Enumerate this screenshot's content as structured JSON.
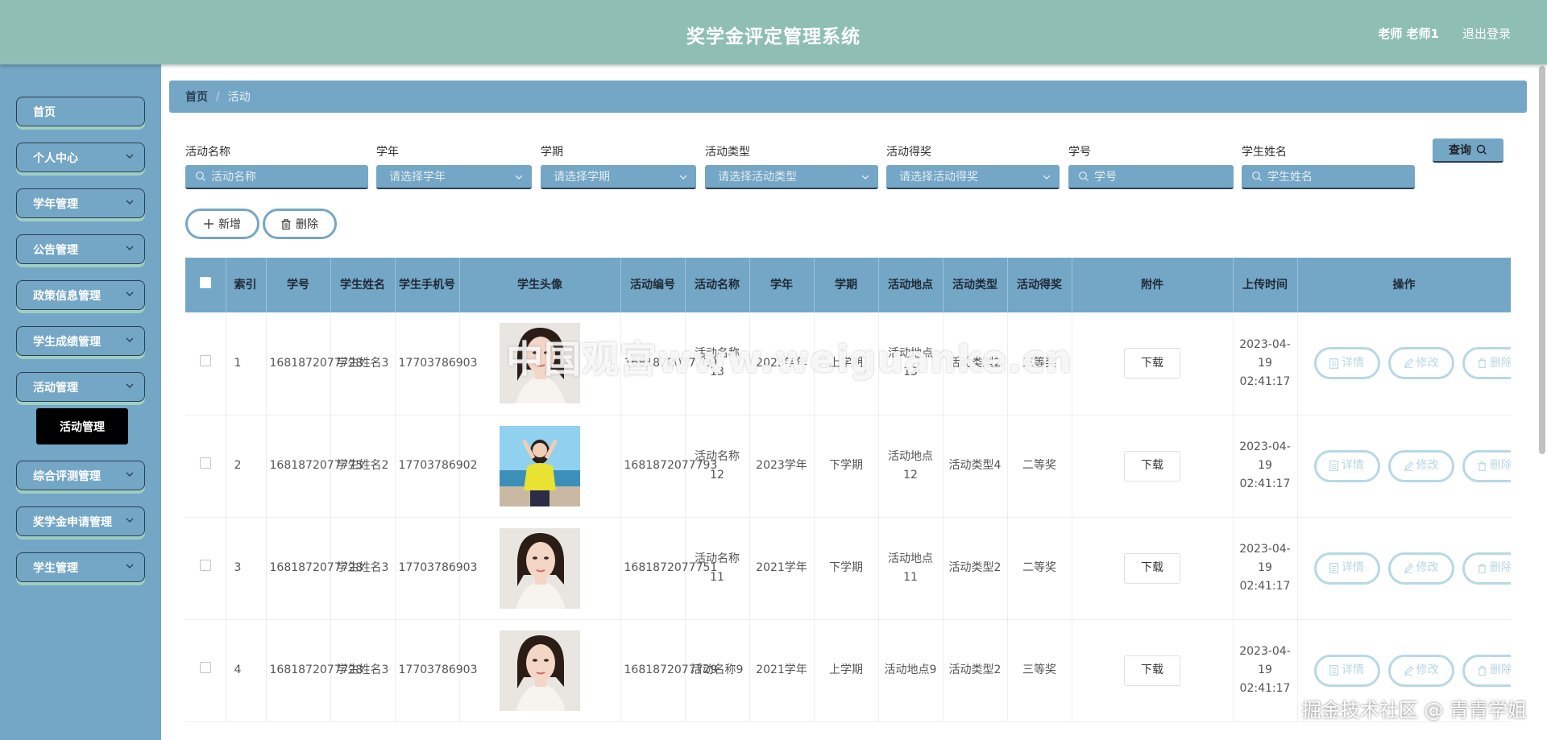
{
  "header": {
    "title": "奖学金评定管理系统",
    "user": "老师 老师1",
    "logout": "退出登录"
  },
  "sidebar": {
    "items": [
      {
        "label": "首页",
        "has_arrow": false
      },
      {
        "label": "个人中心",
        "has_arrow": true
      },
      {
        "label": "学年管理",
        "has_arrow": true
      },
      {
        "label": "公告管理",
        "has_arrow": true
      },
      {
        "label": "政策信息管理",
        "has_arrow": true
      },
      {
        "label": "学生成绩管理",
        "has_arrow": true
      },
      {
        "label": "活动管理",
        "has_arrow": true
      },
      {
        "label": "综合评测管理",
        "has_arrow": true
      },
      {
        "label": "奖学金申请管理",
        "has_arrow": true
      },
      {
        "label": "学生管理",
        "has_arrow": true
      }
    ],
    "active_sub": "活动管理"
  },
  "breadcrumb": {
    "home": "首页",
    "separator": "/",
    "current": "活动"
  },
  "filters": [
    {
      "label": "活动名称",
      "placeholder": "活动名称",
      "type": "input"
    },
    {
      "label": "学年",
      "placeholder": "请选择学年",
      "type": "select"
    },
    {
      "label": "学期",
      "placeholder": "请选择学期",
      "type": "select"
    },
    {
      "label": "活动类型",
      "placeholder": "请选择活动类型",
      "type": "select"
    },
    {
      "label": "活动得奖",
      "placeholder": "请选择活动得奖",
      "type": "select"
    },
    {
      "label": "学号",
      "placeholder": "学号",
      "type": "input"
    },
    {
      "label": "学生姓名",
      "placeholder": "学生姓名",
      "type": "input"
    }
  ],
  "query_label": "查询",
  "actions": {
    "add": "新增",
    "delete": "删除"
  },
  "table": {
    "headers": [
      "索引",
      "学号",
      "学生姓名",
      "学生手机号",
      "学生头像",
      "活动编号",
      "活动名称",
      "学年",
      "学期",
      "活动地点",
      "活动类型",
      "活动得奖",
      "附件",
      "上传时间",
      "操作"
    ],
    "rows": [
      {
        "index": "1",
        "student_id": "1681872077728",
        "student_name": "学生姓名3",
        "phone": "17703786903",
        "avatar": "portrait-a",
        "activity_id": "1681872077719",
        "activity_name": "活动名称13",
        "year": "2023学年",
        "term": "上学期",
        "location": "活动地点13",
        "type": "活动类型2",
        "award": "三等奖",
        "upload_time": "2023-04-19 02:41:17"
      },
      {
        "index": "2",
        "student_id": "1681872077775",
        "student_name": "学生姓名2",
        "phone": "17703786902",
        "avatar": "portrait-b",
        "activity_id": "1681872077793",
        "activity_name": "活动名称12",
        "year": "2023学年",
        "term": "下学期",
        "location": "活动地点12",
        "type": "活动类型4",
        "award": "二等奖",
        "upload_time": "2023-04-19 02:41:17"
      },
      {
        "index": "3",
        "student_id": "1681872077728",
        "student_name": "学生姓名3",
        "phone": "17703786903",
        "avatar": "portrait-a",
        "activity_id": "1681872077751",
        "activity_name": "活动名称11",
        "year": "2021学年",
        "term": "下学期",
        "location": "活动地点11",
        "type": "活动类型2",
        "award": "二等奖",
        "upload_time": "2023-04-19 02:41:17"
      },
      {
        "index": "4",
        "student_id": "1681872077728",
        "student_name": "学生姓名3",
        "phone": "17703786903",
        "avatar": "portrait-a",
        "activity_id": "1681872077729",
        "activity_name": "活动名称9",
        "year": "2021学年",
        "term": "上学期",
        "location": "活动地点9",
        "type": "活动类型2",
        "award": "三等奖",
        "upload_time": "2023-04-19 02:41:17"
      }
    ],
    "download_label": "下载",
    "ops": [
      "详情",
      "修改",
      "删除"
    ]
  },
  "overlay": {
    "watermark": "中国观宫www.weiguanke.cn",
    "credit": "掘金技术社区 @ 青青学姐"
  },
  "colors": {
    "header": "#8fbfb4",
    "sidebar": "#74a6c6",
    "accent": "#74a6c6",
    "op_border": "#b7d8e5"
  }
}
